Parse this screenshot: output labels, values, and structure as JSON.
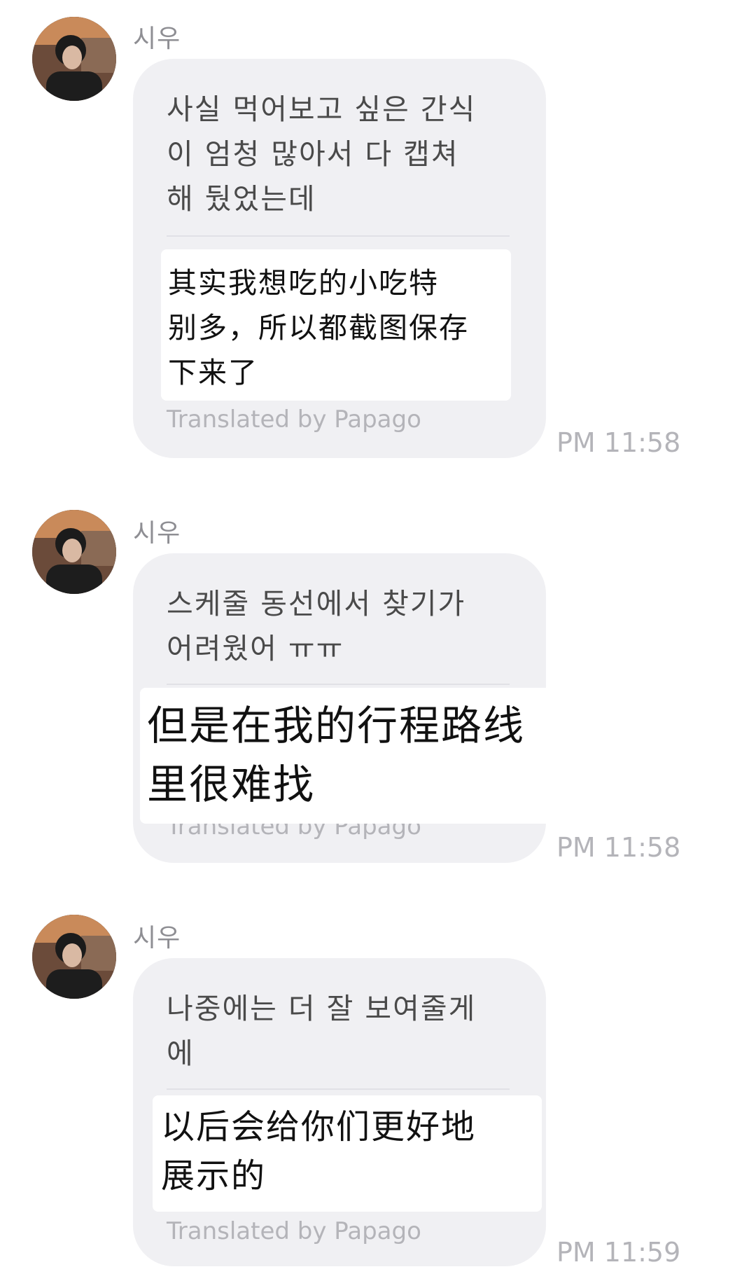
{
  "messages": [
    {
      "sender": "시우",
      "original": "사실 먹어보고 싶은 간식이 엄청 많아서 다 캡쳐해 뒀었는데",
      "original_lines": [
        "사실 먹어보고 싶은 간식",
        "이 엄청 많아서 다 캡쳐",
        "해 뒀었는데"
      ],
      "translation_lines": [
        "其实我想吃的小吃特",
        "别多，所以都截图保存",
        "下来了"
      ],
      "translated_by": "Translated by Papago",
      "time": "PM 11:58"
    },
    {
      "sender": "시우",
      "original_lines": [
        "스케줄 동선에서 찾기가",
        "어려웠어 ㅠㅠ"
      ],
      "translation_lines": [
        "但是在我的行程路线",
        "里很难找"
      ],
      "translated_by": "Translated by Papago",
      "time": "PM 11:58"
    },
    {
      "sender": "시우",
      "original_lines": [
        "나중에는 더 잘 보여줄게",
        "에"
      ],
      "translation_lines": [
        "以后会给你们更好地",
        "展示的"
      ],
      "translated_by": "Translated by Papago",
      "time": "PM 11:59"
    }
  ],
  "colors": {
    "bubble": "#f0f0f3",
    "translation_box": "#ffffff",
    "meta_text": "#b4b4b9",
    "sender_text": "#8e8e93"
  }
}
